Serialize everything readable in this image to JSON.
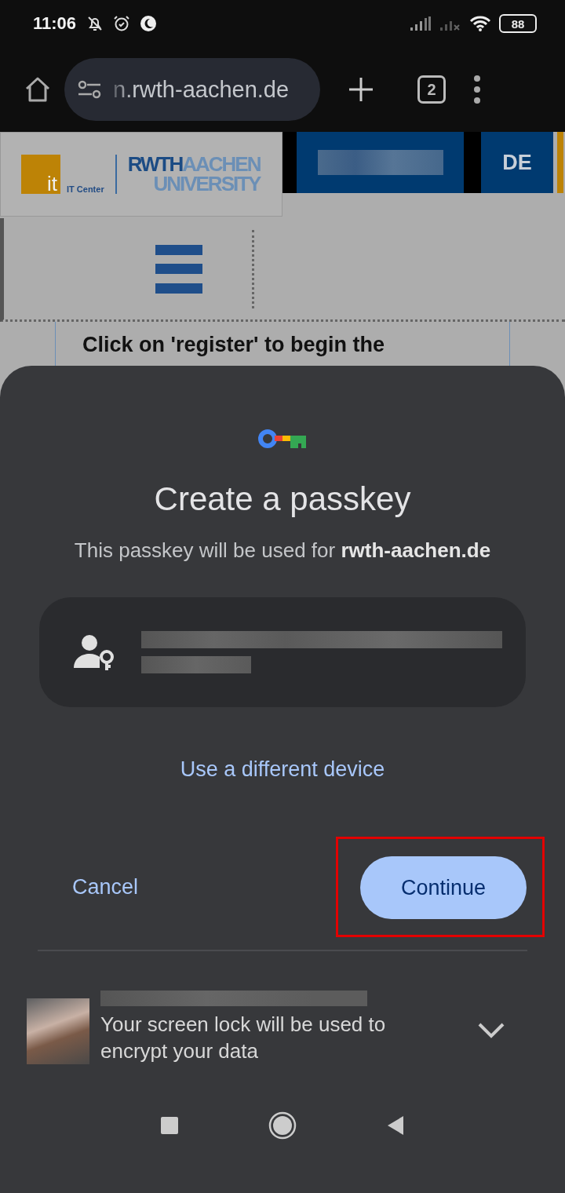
{
  "status_bar": {
    "time": "11:06",
    "battery": "88"
  },
  "browser": {
    "url": "n.rwth-aachen.de",
    "tab_count": "2"
  },
  "site": {
    "logo_it": "it",
    "logo_center": "IT Center",
    "logo_rwth": "RWTH",
    "logo_aachen": "AACHEN",
    "logo_university": "UNIVERSITY",
    "language": "DE",
    "content_text": "Click on 'register' to begin the"
  },
  "sheet": {
    "title": "Create a passkey",
    "subtitle": "This passkey will be used for **rwth-aachen.de**",
    "alt_link": "Use a different device",
    "cancel": "Cancel",
    "continue": "Continue",
    "continue_highlighted": true,
    "footer_text": "Your screen lock will be used to encrypt your data"
  }
}
